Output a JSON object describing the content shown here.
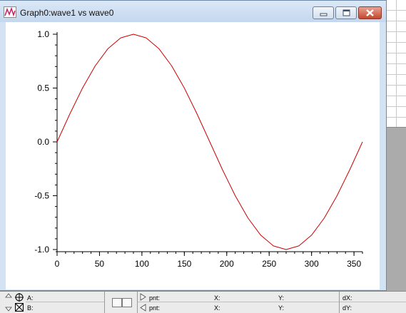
{
  "window": {
    "title": "Graph0:wave1 vs wave0"
  },
  "chart_data": {
    "type": "line",
    "function": "sin(x degrees)",
    "x": [
      0,
      15,
      30,
      45,
      60,
      75,
      90,
      105,
      120,
      135,
      150,
      165,
      180,
      195,
      210,
      225,
      240,
      255,
      270,
      285,
      300,
      315,
      330,
      345,
      360
    ],
    "series": [
      {
        "color": "#cc0000",
        "values": [
          0.0,
          0.259,
          0.5,
          0.707,
          0.866,
          0.966,
          1.0,
          0.966,
          0.866,
          0.707,
          0.5,
          0.259,
          0.0,
          -0.259,
          -0.5,
          -0.707,
          -0.866,
          -0.966,
          -1.0,
          -0.966,
          -0.866,
          -0.707,
          -0.5,
          -0.259,
          0.0
        ]
      }
    ],
    "xlim": [
      0,
      360
    ],
    "ylim": [
      -1.0,
      1.0
    ],
    "xticks": [
      0,
      50,
      100,
      150,
      200,
      250,
      300,
      350
    ],
    "xtick_labels": [
      "0",
      "50",
      "100",
      "150",
      "200",
      "250",
      "300",
      "350"
    ],
    "yticks": [
      1.0,
      0.5,
      0.0,
      -0.5,
      -1.0
    ],
    "ytick_labels": [
      "1.0",
      "0.5",
      "0.0",
      "-0.5",
      "-1.0"
    ],
    "grid": false
  },
  "info_panel": {
    "cursor_a": "A:",
    "cursor_b": "B:",
    "pnt_label": "pnt:",
    "x_label": "X:",
    "y_label": "Y:",
    "dx_label": "dX:",
    "dy_label": "dY:"
  }
}
